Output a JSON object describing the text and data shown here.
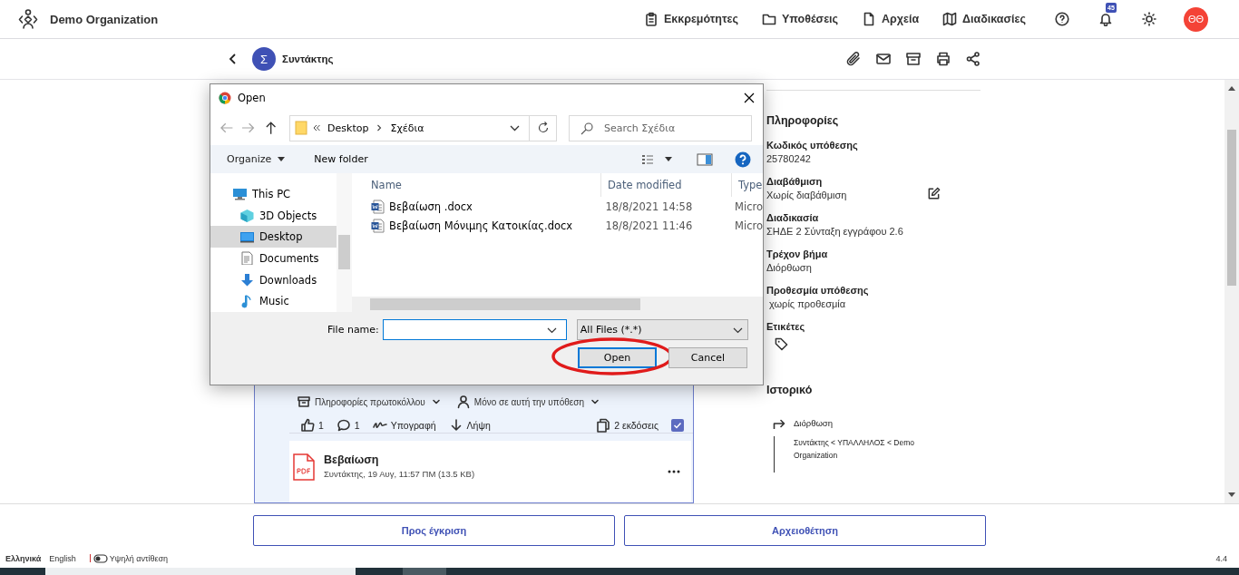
{
  "header": {
    "organization": "Demo Organization",
    "nav": [
      {
        "label": "Εκκρεμότητες"
      },
      {
        "label": "Υποθέσεις"
      },
      {
        "label": "Αρχεία"
      },
      {
        "label": "Διαδικασίες"
      }
    ],
    "notifications": "45",
    "avatar": "ΘΘ"
  },
  "subheader": {
    "avatar": "Σ",
    "title": "Συντάκτης"
  },
  "document_card": {
    "filters": [
      "Πληροφορίες πρωτοκόλλου",
      "Μόνο σε αυτή την υπόθεση"
    ],
    "likes": "1",
    "comments": "1",
    "sign": "Υπογραφή",
    "download": "Λήψη",
    "versions": "2 εκδόσεις",
    "checked": true,
    "attachment": {
      "title": "Βεβαίωση",
      "meta": "Συντάκτης,  19 Αυγ, 11:57 ΠΜ (13.5 KB)"
    }
  },
  "info_panel": {
    "title": "Πληροφορίες",
    "fields": [
      {
        "label": "Κωδικός υπόθεσης",
        "value": "25780242",
        "editable": false
      },
      {
        "label": "Διαβάθμιση",
        "value": "Χωρίς διαβάθμιση",
        "editable": true
      },
      {
        "label": "Διαδικασία",
        "value": "ΣΗΔΕ 2 Σύνταξη εγγράφου 2.6",
        "editable": false
      },
      {
        "label": "Τρέχον βήμα",
        "value": "Διόρθωση",
        "editable": false
      },
      {
        "label": "Προθεσμία υπόθεσης",
        "value": " χωρίς προθεσμία",
        "editable": false
      }
    ],
    "tags_label": "Ετικέτες",
    "history_title": "Ιστορικό",
    "history": [
      {
        "step": "Διόρθωση",
        "path": "Συντάκτης < ΥΠΑΛΛΗΛΟΣ < Demo Organization"
      }
    ]
  },
  "actions": [
    "Προς έγκριση",
    "Αρχειοθέτηση"
  ],
  "footer": {
    "languages": [
      {
        "label": "Ελληνικά",
        "selected": true
      },
      {
        "label": "English",
        "selected": false
      }
    ],
    "contrast": "Υψηλή αντίθεση",
    "version": "4.4"
  },
  "dialog": {
    "title": "Open",
    "breadcrumb": [
      "Desktop",
      "Σχέδια"
    ],
    "search_placeholder": "Search Σχέδια",
    "organize": "Organize",
    "new_folder": "New folder",
    "tree": [
      {
        "label": "This PC",
        "selected": false
      },
      {
        "label": "3D Objects",
        "selected": false
      },
      {
        "label": "Desktop",
        "selected": true
      },
      {
        "label": "Documents",
        "selected": false
      },
      {
        "label": "Downloads",
        "selected": false
      },
      {
        "label": "Music",
        "selected": false
      }
    ],
    "columns": [
      "Name",
      "Date modified",
      "Type"
    ],
    "files": [
      {
        "name": "Βεβαίωση .docx",
        "date": "18/8/2021 14:58",
        "type": "Micro"
      },
      {
        "name": "Βεβαίωση Μόνιμης Κατοικίας.docx",
        "date": "18/8/2021 11:46",
        "type": "Micro"
      }
    ],
    "file_name_label": "File name:",
    "filter": "All Files (*.*)",
    "buttons": [
      {
        "label": "Open",
        "focused": true,
        "highlighted": true
      },
      {
        "label": "Cancel",
        "focused": false,
        "highlighted": false
      }
    ]
  }
}
